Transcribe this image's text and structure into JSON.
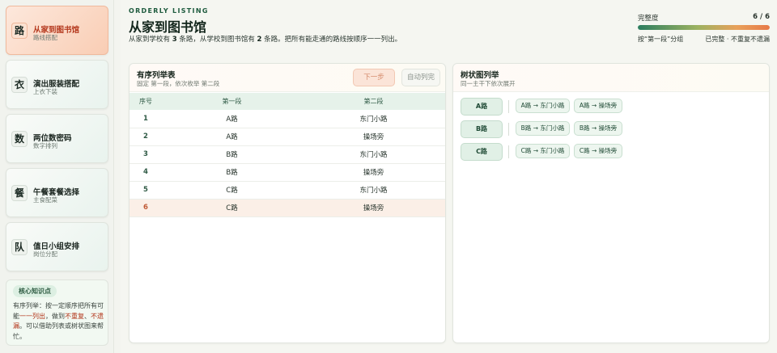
{
  "sidebar": {
    "lessons": [
      {
        "icon": "路",
        "title": "从家到图书馆",
        "sub": "路线搭配",
        "active": true
      },
      {
        "icon": "衣",
        "title": "演出服装搭配",
        "sub": "上衣下装",
        "active": false
      },
      {
        "icon": "数",
        "title": "两位数密码",
        "sub": "数字排列",
        "active": false
      },
      {
        "icon": "餐",
        "title": "午餐套餐选择",
        "sub": "主食配菜",
        "active": false
      },
      {
        "icon": "队",
        "title": "值日小组安排",
        "sub": "岗位分配",
        "active": false
      }
    ],
    "knowledge": {
      "title": "核心知识点",
      "body_prefix": "有序列举：按一定顺序把所有可能",
      "body_hl1": "一一列出",
      "body_mid": "，做到",
      "body_hl2": "不重复",
      "body_sep": "、",
      "body_hl3": "不遗漏",
      "body_suffix": "。可以借助列表或树状图来帮忙。"
    }
  },
  "header": {
    "eyebrow": "ORDERLY LISTING",
    "title": "从家到图书馆",
    "desc_a": "从家到学校有 ",
    "desc_n1": "3",
    "desc_b": " 条路，从学校到图书馆有 ",
    "desc_n2": "2",
    "desc_c": " 条路。把所有能走通的路线按顺序一一列出。"
  },
  "progress": {
    "label": "完整度",
    "count": "6 / 6",
    "fraction": 1.0,
    "note_left": "按“第一段”分组",
    "note_right": "已完整 · 不重复不遗漏"
  },
  "list_panel": {
    "title": "有序列举表",
    "sub": "固定 第一段，依次枚举 第二段",
    "next_label": "下一步",
    "auto_label": "自动列完",
    "columns": [
      "序号",
      "第一段",
      "第二段"
    ],
    "rows": [
      {
        "idx": "1",
        "a": "A路",
        "b": "东门小路"
      },
      {
        "idx": "2",
        "a": "A路",
        "b": "操场旁"
      },
      {
        "idx": "3",
        "a": "B路",
        "b": "东门小路"
      },
      {
        "idx": "4",
        "a": "B路",
        "b": "操场旁"
      },
      {
        "idx": "5",
        "a": "C路",
        "b": "东门小路"
      },
      {
        "idx": "6",
        "a": "C路",
        "b": "操场旁"
      }
    ]
  },
  "tree_panel": {
    "title": "树状图列举",
    "sub": "同一主干下依次展开",
    "branches": [
      {
        "root": "A路",
        "leaves": [
          "A路 → 东门小路",
          "A路 → 操场旁"
        ]
      },
      {
        "root": "B路",
        "leaves": [
          "B路 → 东门小路",
          "B路 → 操场旁"
        ]
      },
      {
        "root": "C路",
        "leaves": [
          "C路 → 东门小路",
          "C路 → 操场旁"
        ]
      }
    ]
  }
}
